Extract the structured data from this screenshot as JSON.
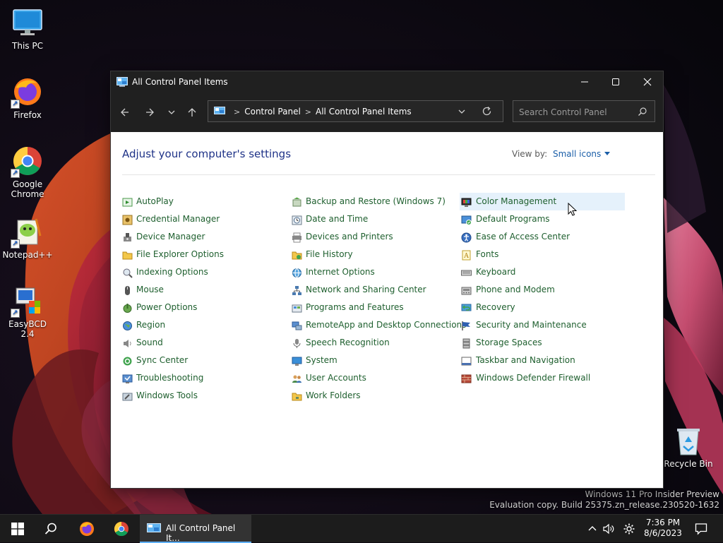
{
  "desktop": {
    "icons": [
      {
        "label": "This PC"
      },
      {
        "label": "Firefox"
      },
      {
        "label": "Google Chrome"
      },
      {
        "label": "Notepad++"
      },
      {
        "label": "EasyBCD 2.4"
      },
      {
        "label": "Recycle Bin"
      }
    ],
    "watermark": {
      "line1": "Windows 11 Pro Insider Preview",
      "line2": "Evaluation copy. Build 25375.zn_release.230520-1632"
    }
  },
  "window": {
    "title": "All Control Panel Items",
    "breadcrumb": [
      "Control Panel",
      "All Control Panel Items"
    ],
    "search_placeholder": "Search Control Panel",
    "heading": "Adjust your computer's settings",
    "view_by_label": "View by:",
    "view_by_value": "Small icons",
    "columns": [
      [
        {
          "label": "AutoPlay",
          "icon": "autoplay-icon"
        },
        {
          "label": "Credential Manager",
          "icon": "credential-icon"
        },
        {
          "label": "Device Manager",
          "icon": "device-manager-icon"
        },
        {
          "label": "File Explorer Options",
          "icon": "folder-options-icon"
        },
        {
          "label": "Indexing Options",
          "icon": "indexing-icon"
        },
        {
          "label": "Mouse",
          "icon": "mouse-icon"
        },
        {
          "label": "Power Options",
          "icon": "power-icon"
        },
        {
          "label": "Region",
          "icon": "region-icon"
        },
        {
          "label": "Sound",
          "icon": "sound-icon"
        },
        {
          "label": "Sync Center",
          "icon": "sync-icon"
        },
        {
          "label": "Troubleshooting",
          "icon": "troubleshoot-icon"
        },
        {
          "label": "Windows Tools",
          "icon": "tools-icon"
        }
      ],
      [
        {
          "label": "Backup and Restore (Windows 7)",
          "icon": "backup-icon"
        },
        {
          "label": "Date and Time",
          "icon": "clock-icon"
        },
        {
          "label": "Devices and Printers",
          "icon": "printer-icon"
        },
        {
          "label": "File History",
          "icon": "file-history-icon"
        },
        {
          "label": "Internet Options",
          "icon": "internet-icon"
        },
        {
          "label": "Network and Sharing Center",
          "icon": "network-icon"
        },
        {
          "label": "Programs and Features",
          "icon": "programs-icon"
        },
        {
          "label": "RemoteApp and Desktop Connections",
          "icon": "remote-icon"
        },
        {
          "label": "Speech Recognition",
          "icon": "microphone-icon"
        },
        {
          "label": "System",
          "icon": "system-icon"
        },
        {
          "label": "User Accounts",
          "icon": "users-icon"
        },
        {
          "label": "Work Folders",
          "icon": "work-folders-icon"
        }
      ],
      [
        {
          "label": "Color Management",
          "icon": "color-management-icon"
        },
        {
          "label": "Default Programs",
          "icon": "default-programs-icon"
        },
        {
          "label": "Ease of Access Center",
          "icon": "ease-of-access-icon"
        },
        {
          "label": "Fonts",
          "icon": "fonts-icon"
        },
        {
          "label": "Keyboard",
          "icon": "keyboard-icon"
        },
        {
          "label": "Phone and Modem",
          "icon": "phone-icon"
        },
        {
          "label": "Recovery",
          "icon": "recovery-icon"
        },
        {
          "label": "Security and Maintenance",
          "icon": "flag-icon"
        },
        {
          "label": "Storage Spaces",
          "icon": "storage-icon"
        },
        {
          "label": "Taskbar and Navigation",
          "icon": "taskbar-icon"
        },
        {
          "label": "Windows Defender Firewall",
          "icon": "firewall-icon"
        }
      ]
    ]
  },
  "taskbar": {
    "app_label": "All Control Panel It...",
    "time": "7:36 PM",
    "date": "8/6/2023"
  }
}
